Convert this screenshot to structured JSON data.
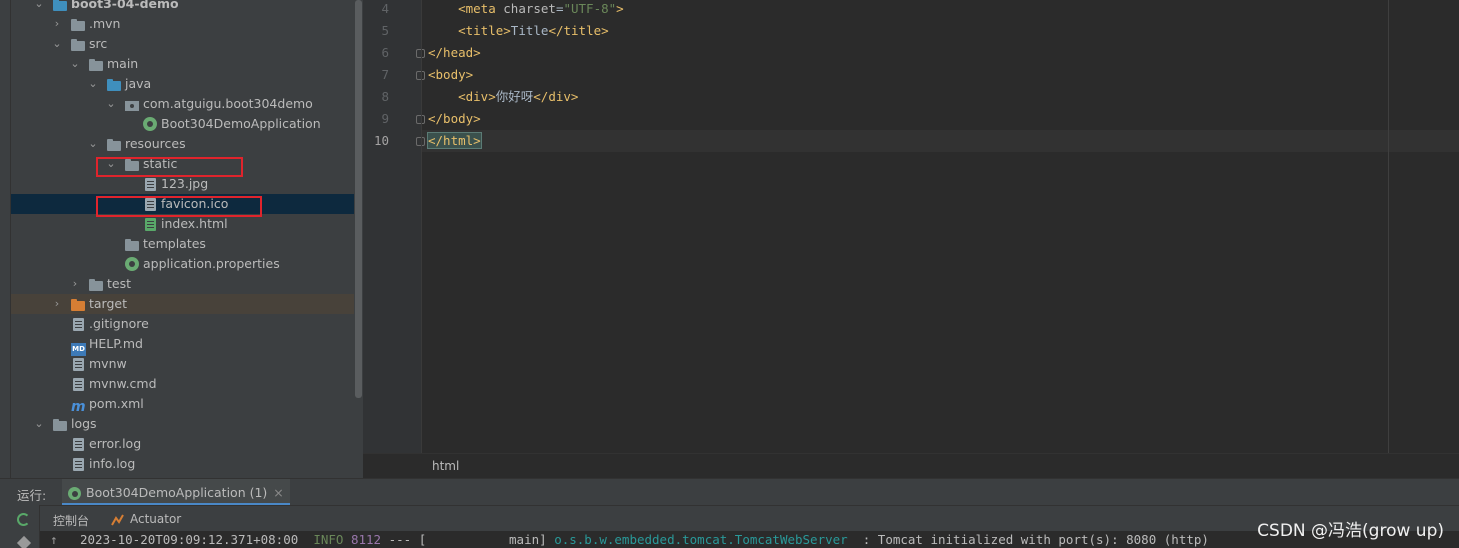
{
  "project_tree": [
    {
      "label": "boot3-04-demo",
      "depth": 2,
      "expanded": true,
      "icon": "module-folder-icon",
      "bold": true
    },
    {
      "label": ".mvn",
      "depth": 3,
      "expanded": false,
      "icon": "folder-icon"
    },
    {
      "label": "src",
      "depth": 3,
      "expanded": true,
      "icon": "folder-icon"
    },
    {
      "label": "main",
      "depth": 4,
      "expanded": true,
      "icon": "folder-icon"
    },
    {
      "label": "java",
      "depth": 5,
      "expanded": true,
      "icon": "source-folder-icon"
    },
    {
      "label": "com.atguigu.boot304demo",
      "depth": 6,
      "expanded": true,
      "icon": "package-icon"
    },
    {
      "label": "Boot304DemoApplication",
      "depth": 7,
      "icon": "spring-boot-class-icon"
    },
    {
      "label": "resources",
      "depth": 5,
      "expanded": true,
      "icon": "resources-folder-icon"
    },
    {
      "label": "static",
      "depth": 6,
      "expanded": true,
      "icon": "folder-icon"
    },
    {
      "label": "123.jpg",
      "depth": 7,
      "icon": "image-file-icon"
    },
    {
      "label": "favicon.ico",
      "depth": 7,
      "icon": "file-icon",
      "selected": true
    },
    {
      "label": "index.html",
      "depth": 7,
      "icon": "html-file-icon"
    },
    {
      "label": "templates",
      "depth": 6,
      "icon": "folder-icon"
    },
    {
      "label": "application.properties",
      "depth": 6,
      "icon": "spring-properties-icon"
    },
    {
      "label": "test",
      "depth": 4,
      "expanded": false,
      "icon": "folder-icon"
    },
    {
      "label": "target",
      "depth": 3,
      "expanded": false,
      "icon": "excluded-folder-icon",
      "excluded": true
    },
    {
      "label": ".gitignore",
      "depth": 3,
      "icon": "gitignore-file-icon"
    },
    {
      "label": "HELP.md",
      "depth": 3,
      "icon": "markdown-file-icon"
    },
    {
      "label": "mvnw",
      "depth": 3,
      "icon": "file-icon"
    },
    {
      "label": "mvnw.cmd",
      "depth": 3,
      "icon": "file-icon"
    },
    {
      "label": "pom.xml",
      "depth": 3,
      "icon": "maven-file-icon"
    },
    {
      "label": "logs",
      "depth": 2,
      "expanded": true,
      "icon": "folder-icon"
    },
    {
      "label": "error.log",
      "depth": 3,
      "icon": "file-icon"
    },
    {
      "label": "info.log",
      "depth": 3,
      "icon": "file-icon"
    }
  ],
  "editor": {
    "line_numbers": [
      "4",
      "5",
      "6",
      "7",
      "8",
      "9",
      "10"
    ],
    "current_line": "10",
    "lines": [
      [
        {
          "t": "    "
        },
        {
          "t": "<meta ",
          "c": "tag"
        },
        {
          "t": "charset",
          "c": "attr"
        },
        {
          "t": "=",
          "c": "txt"
        },
        {
          "t": "\"UTF-8\"",
          "c": "str"
        },
        {
          "t": ">",
          "c": "tag"
        }
      ],
      [
        {
          "t": "    "
        },
        {
          "t": "<title>",
          "c": "tag"
        },
        {
          "t": "Title",
          "c": "txt"
        },
        {
          "t": "</title>",
          "c": "tag"
        }
      ],
      [
        {
          "t": "</head>",
          "c": "tag"
        }
      ],
      [
        {
          "t": "<body>",
          "c": "tag"
        }
      ],
      [
        {
          "t": "    "
        },
        {
          "t": "<div>",
          "c": "tag"
        },
        {
          "t": "你好呀",
          "c": "txt"
        },
        {
          "t": "</div>",
          "c": "tag"
        }
      ],
      [
        {
          "t": "</body>",
          "c": "tag"
        }
      ],
      [
        {
          "t": "</html>",
          "c": "tag caret-box"
        }
      ]
    ],
    "breadcrumb": "html"
  },
  "run_panel": {
    "label": "运行:",
    "tab": "Boot304DemoApplication (1)",
    "close_glyph": "×",
    "console_tab": "控制台",
    "actuator_tab": "Actuator"
  },
  "console": {
    "up_glyph": "↑",
    "timestamp": "2023-10-20T09:09:12.371+08:00",
    "level": "INFO",
    "pid": "8112",
    "sep": "--- [",
    "thread": "           main]",
    "logger": "o.s.b.w.embedded.tomcat.TomcatWebServer",
    "message": "  : Tomcat initialized with port(s): 8080 (http)"
  },
  "watermark": "CSDN @冯浩(grow up)"
}
